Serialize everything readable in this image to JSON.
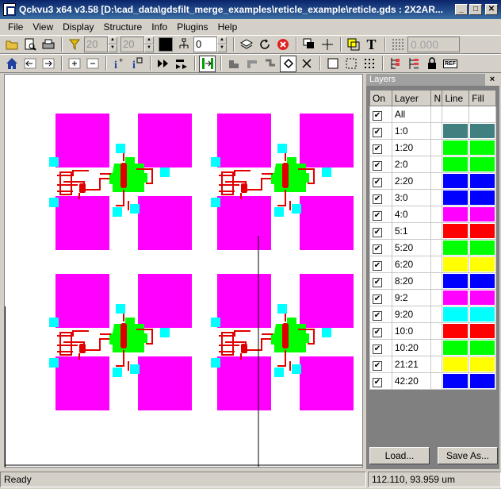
{
  "window": {
    "title": "Qckvu3 x64 v3.58 [D:\\cad_data\\gdsfilt_merge_examples\\reticle_example\\reticle.gds : 2X2AR...",
    "minimize": "_",
    "maximize": "□",
    "close": "✕"
  },
  "menu": [
    "File",
    "View",
    "Display",
    "Structure",
    "Info",
    "Plugins",
    "Help"
  ],
  "toolbar1": {
    "level_from": "20",
    "level_to": "20",
    "array_count": "0",
    "coord_value": "0.000",
    "icons": [
      "open-icon",
      "print-preview-icon",
      "print-icon",
      "filter-icon",
      "fill-color-icon",
      "hierarchy-icon",
      "layers-icon",
      "refresh-icon",
      "stop-icon",
      "overlap-icon",
      "crosshair-icon",
      "highlight-icon",
      "text-icon",
      "grid-icon"
    ]
  },
  "toolbar2": {
    "icons": [
      "home-icon",
      "back-icon",
      "forward-icon",
      "zoom-in-icon",
      "zoom-out-icon",
      "info-icon",
      "info-area-icon",
      "step-icon",
      "steps-icon",
      "fit-icon",
      "pan-icon",
      "move-icon",
      "measure-icon",
      "diamond-icon",
      "clear-icon",
      "box-icon",
      "select-box-icon",
      "dots-icon",
      "tree-icon",
      "tree-alt-icon",
      "lock-icon",
      "ref-icon"
    ],
    "ref_label": "REF"
  },
  "layers_panel": {
    "title": "Layers",
    "close": "×",
    "headers": [
      "On",
      "Layer",
      "N",
      "Line",
      "Fill"
    ],
    "rows": [
      {
        "layer": "All",
        "on": true,
        "color": ""
      },
      {
        "layer": "1:0",
        "on": true,
        "color": "#408080"
      },
      {
        "layer": "1:20",
        "on": true,
        "color": "#00ff00"
      },
      {
        "layer": "2:0",
        "on": true,
        "color": "#00ff00"
      },
      {
        "layer": "2:20",
        "on": true,
        "color": "#0000ff"
      },
      {
        "layer": "3:0",
        "on": true,
        "color": "#0000ff"
      },
      {
        "layer": "4:0",
        "on": true,
        "color": "#ff00ff"
      },
      {
        "layer": "5:1",
        "on": true,
        "color": "#ff0000"
      },
      {
        "layer": "5:20",
        "on": true,
        "color": "#00ff00"
      },
      {
        "layer": "6:20",
        "on": true,
        "color": "#ffff00"
      },
      {
        "layer": "8:20",
        "on": true,
        "color": "#0000ff"
      },
      {
        "layer": "9:2",
        "on": true,
        "color": "#ff00ff"
      },
      {
        "layer": "9:20",
        "on": true,
        "color": "#00ffff"
      },
      {
        "layer": "10:0",
        "on": true,
        "color": "#ff0000"
      },
      {
        "layer": "10:20",
        "on": true,
        "color": "#00ff00"
      },
      {
        "layer": "21:21",
        "on": true,
        "color": "#ffff00"
      },
      {
        "layer": "42:20",
        "on": true,
        "color": "#0000ff"
      }
    ],
    "load_button": "Load...",
    "save_button": "Save As..."
  },
  "status": {
    "message": "Ready",
    "coordinates": "112.110, 93.959 um"
  },
  "colors": {
    "pad": "#ff00ff",
    "trace": "#e00000",
    "core": "#00ff00",
    "via": "#00ffff"
  }
}
